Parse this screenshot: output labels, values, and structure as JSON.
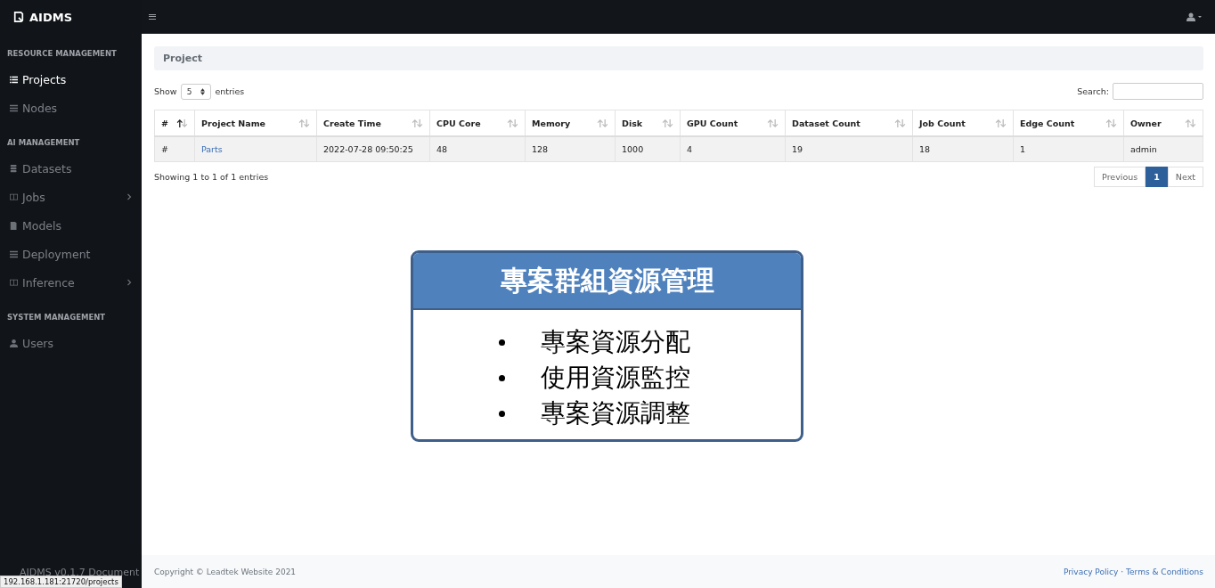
{
  "brand": {
    "name": "AIDMS"
  },
  "sidebar": {
    "sections": [
      {
        "heading": "RESOURCE MANAGEMENT",
        "items": [
          {
            "label": "Projects",
            "selected": true
          },
          {
            "label": "Nodes",
            "selected": false
          }
        ]
      },
      {
        "heading": "AI MANAGEMENT",
        "items": [
          {
            "label": "Datasets",
            "selected": false
          },
          {
            "label": "Jobs",
            "selected": false,
            "expanded": false
          },
          {
            "label": "Models",
            "selected": false
          },
          {
            "label": "Deployment",
            "selected": false
          },
          {
            "label": "Inference",
            "selected": false,
            "expanded": false
          }
        ]
      },
      {
        "heading": "SYSTEM MANAGEMENT",
        "items": [
          {
            "label": "Users",
            "selected": false
          }
        ]
      }
    ],
    "footer": "AIDMS v0.1.7 Document"
  },
  "status_url": "192.168.1.181:21720/projects",
  "page": {
    "title": "Project",
    "length": {
      "before": "Show",
      "value": "5",
      "after": "entries"
    },
    "search": {
      "label": "Search:"
    },
    "table": {
      "columns": [
        {
          "label": "#",
          "sorted": true
        },
        {
          "label": "Project Name",
          "sorted": false
        },
        {
          "label": "Create Time",
          "sorted": false
        },
        {
          "label": "CPU Core",
          "sorted": false
        },
        {
          "label": "Memory",
          "sorted": false
        },
        {
          "label": "Disk",
          "sorted": false
        },
        {
          "label": "GPU Count",
          "sorted": false
        },
        {
          "label": "Dataset Count",
          "sorted": false
        },
        {
          "label": "Job Count",
          "sorted": false
        },
        {
          "label": "Edge Count",
          "sorted": false
        },
        {
          "label": "Owner",
          "sorted": false
        }
      ],
      "rows": [
        [
          "#",
          "Parts",
          "2022-07-28 09:50:25",
          "48",
          "128",
          "1000",
          "4",
          "19",
          "18",
          "1",
          "admin"
        ]
      ]
    },
    "info": "Showing 1 to 1 of 1 entries",
    "pagination": [
      {
        "label": "Previous",
        "selected": false
      },
      {
        "label": "1",
        "selected": true
      },
      {
        "label": "Next",
        "selected": false
      }
    ]
  },
  "footer": {
    "copyright": "Copyright © Leadtek Website 2021",
    "links": [
      "Privacy Policy",
      "Terms & Conditions"
    ],
    "separator": "·"
  },
  "callout": {
    "title": "專案群組資源管理",
    "bullets": [
      "專案資源分配",
      "使用資源監控",
      "專案資源調整"
    ]
  }
}
